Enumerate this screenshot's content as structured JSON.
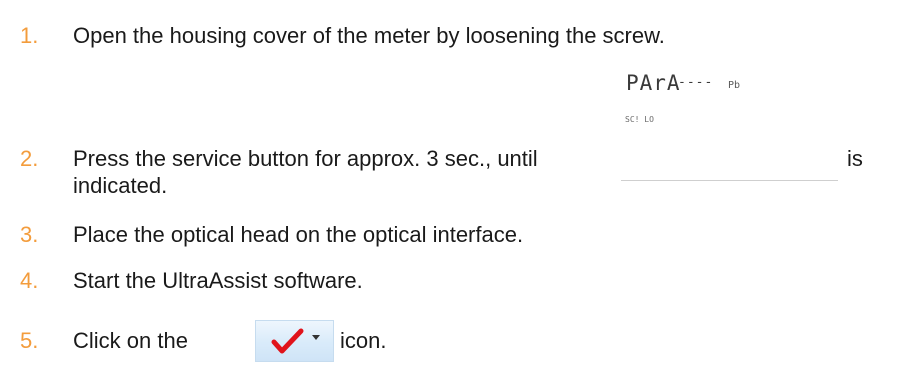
{
  "steps": [
    {
      "number": "1.",
      "text": "Open the housing cover of the meter by loosening the screw."
    },
    {
      "number": "2.",
      "text_before": "Press the service button for approx. 3 sec., until",
      "text_after": "is",
      "text_line2": "indicated."
    },
    {
      "number": "3.",
      "text": "Place the optical head on the optical interface."
    },
    {
      "number": "4.",
      "text": "Start the UltraAssist software."
    },
    {
      "number": "5.",
      "text_before": "Click on the",
      "text_after": "icon."
    }
  ],
  "display": {
    "main": "PArA",
    "dashes": "----",
    "code": "Pb",
    "lower": "SC! LO"
  },
  "icon": {
    "name": "checkmark-dropdown-icon",
    "check_color": "#e0131b",
    "arrow_color": "#333333"
  },
  "colors": {
    "step_number": "#f39c3c",
    "text": "#1a1a1a"
  }
}
